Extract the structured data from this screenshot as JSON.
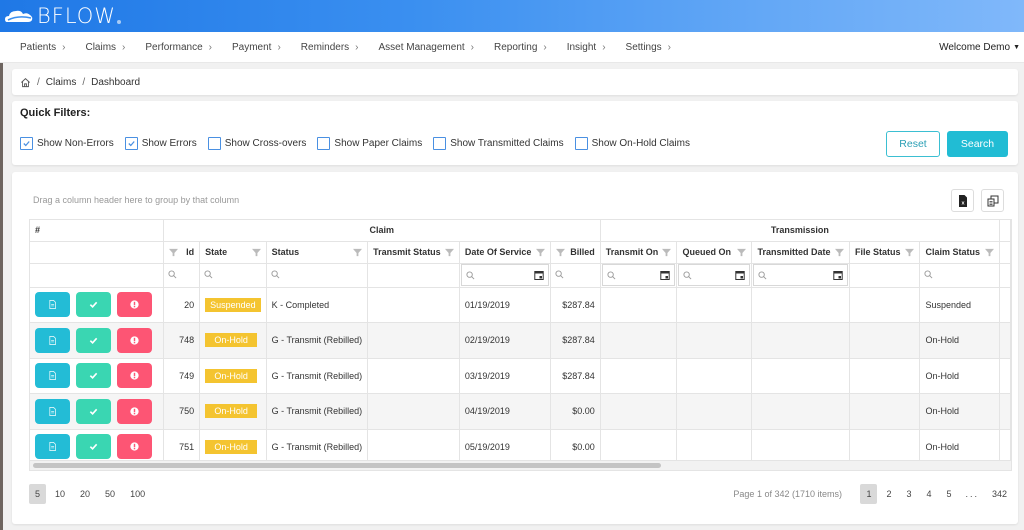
{
  "app": {
    "logo_text": "BFLOW",
    "brand_color": "#1f78e6"
  },
  "nav": {
    "items": [
      {
        "label": "Patients"
      },
      {
        "label": "Claims"
      },
      {
        "label": "Performance"
      },
      {
        "label": "Payment"
      },
      {
        "label": "Reminders"
      },
      {
        "label": "Asset Management"
      },
      {
        "label": "Reporting"
      },
      {
        "label": "Insight"
      },
      {
        "label": "Settings"
      }
    ],
    "welcome": "Welcome Demo"
  },
  "breadcrumb": {
    "items": [
      "Claims",
      "Dashboard"
    ],
    "separator": "/"
  },
  "quick_filters": {
    "title": "Quick Filters:",
    "options": [
      {
        "label": "Show Non-Errors",
        "checked": true
      },
      {
        "label": "Show Errors",
        "checked": true
      },
      {
        "label": "Show Cross-overs",
        "checked": false
      },
      {
        "label": "Show Paper Claims",
        "checked": false
      },
      {
        "label": "Show Transmitted Claims",
        "checked": false
      },
      {
        "label": "Show On-Hold Claims",
        "checked": false
      }
    ],
    "reset_label": "Reset",
    "search_label": "Search"
  },
  "grid": {
    "group_hint": "Drag a column header here to group by that column",
    "bands": {
      "hash": "#",
      "claim": "Claim",
      "transmission": "Transmission"
    },
    "columns": {
      "id": "Id",
      "state": "State",
      "status": "Status",
      "transmit_status": "Transmit Status",
      "date_of_service": "Date Of Service",
      "billed": "Billed",
      "transmit_on": "Transmit On",
      "queued_on": "Queued On",
      "transmitted_date": "Transmitted Date",
      "file_status": "File Status",
      "claim_status": "Claim Status"
    },
    "rows": [
      {
        "id": "20",
        "state": "Suspended",
        "status": "K - Completed",
        "transmit_status": "",
        "date_of_service": "01/19/2019",
        "billed": "$287.84",
        "transmit_on": "",
        "queued_on": "",
        "transmitted_date": "",
        "file_status": "",
        "claim_status": "Suspended"
      },
      {
        "id": "748",
        "state": "On-Hold",
        "status": "G - Transmit (Rebilled)",
        "transmit_status": "",
        "date_of_service": "02/19/2019",
        "billed": "$287.84",
        "transmit_on": "",
        "queued_on": "",
        "transmitted_date": "",
        "file_status": "",
        "claim_status": "On-Hold"
      },
      {
        "id": "749",
        "state": "On-Hold",
        "status": "G - Transmit (Rebilled)",
        "transmit_status": "",
        "date_of_service": "03/19/2019",
        "billed": "$287.84",
        "transmit_on": "",
        "queued_on": "",
        "transmitted_date": "",
        "file_status": "",
        "claim_status": "On-Hold"
      },
      {
        "id": "750",
        "state": "On-Hold",
        "status": "G - Transmit (Rebilled)",
        "transmit_status": "",
        "date_of_service": "04/19/2019",
        "billed": "$0.00",
        "transmit_on": "",
        "queued_on": "",
        "transmitted_date": "",
        "file_status": "",
        "claim_status": "On-Hold"
      },
      {
        "id": "751",
        "state": "On-Hold",
        "status": "G - Transmit (Rebilled)",
        "transmit_status": "",
        "date_of_service": "05/19/2019",
        "billed": "$0.00",
        "transmit_on": "",
        "queued_on": "",
        "transmitted_date": "",
        "file_status": "",
        "claim_status": "On-Hold"
      }
    ],
    "state_badge_color": "#f4c430",
    "action_colors": {
      "view": "#23bcd6",
      "approve": "#3ad6b2",
      "error": "#fd5574"
    }
  },
  "pager": {
    "page_sizes": [
      "5",
      "10",
      "20",
      "50",
      "100"
    ],
    "selected_size": "5",
    "info": "Page 1 of 342 (1710 items)",
    "pages": [
      "1",
      "2",
      "3",
      "4",
      "5"
    ],
    "ellipsis": "...",
    "last_page": "342",
    "current_page": "1"
  }
}
